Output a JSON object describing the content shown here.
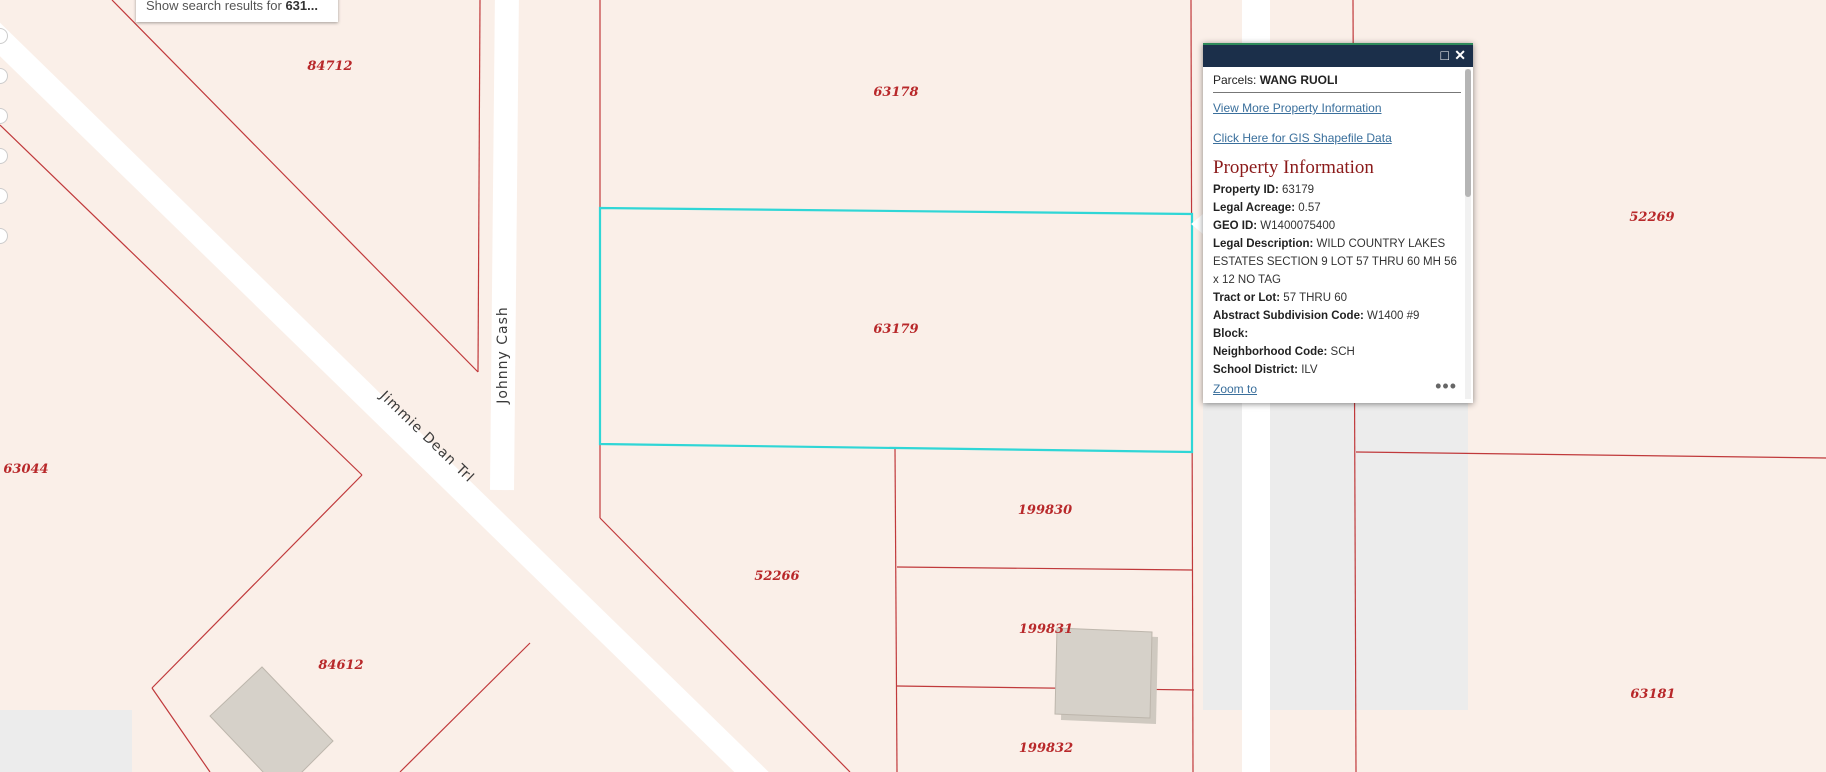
{
  "search": {
    "prefix": "Show search results for ",
    "query": "631..."
  },
  "map": {
    "parcels": [
      "84712",
      "63178",
      "63179",
      "52269",
      "63044",
      "199830",
      "52266",
      "199831",
      "84612",
      "199832",
      "63181"
    ],
    "streets": [
      "Johnny Cash",
      "Jimmie Dean Trl"
    ],
    "colors": {
      "parcel_fill": "#faefe8",
      "parcel_line": "#c0393b",
      "selected_outline": "#2fd6d6",
      "road": "#ffffff",
      "building": "#d6d1c9"
    }
  },
  "popup": {
    "title_prefix": "Parcels: ",
    "title_owner": "WANG RUOLI",
    "link_more": "View More Property Information",
    "link_gis": "Click Here for GIS Shapefile Data",
    "section": "Property Information",
    "fields": [
      {
        "label": "Property ID:",
        "value": "63179"
      },
      {
        "label": "Legal Acreage:",
        "value": "0.57"
      },
      {
        "label": "GEO ID:",
        "value": "W1400075400"
      },
      {
        "label": "Legal Description:",
        "value": "WILD COUNTRY LAKES ESTATES SECTION 9 LOT 57 THRU 60 MH 56 x 12 NO TAG"
      },
      {
        "label": "Tract or Lot:",
        "value": "57 THRU 60"
      },
      {
        "label": "Abstract Subdivision Code:",
        "value": "W1400 #9"
      },
      {
        "label": "Block:",
        "value": ""
      },
      {
        "label": "Neighborhood Code:",
        "value": "SCH"
      },
      {
        "label": "School District:",
        "value": "ILV"
      }
    ],
    "zoom_to": "Zoom to",
    "more": "•••",
    "maximize_icon": "maximize-icon",
    "close_icon": "close-icon"
  }
}
